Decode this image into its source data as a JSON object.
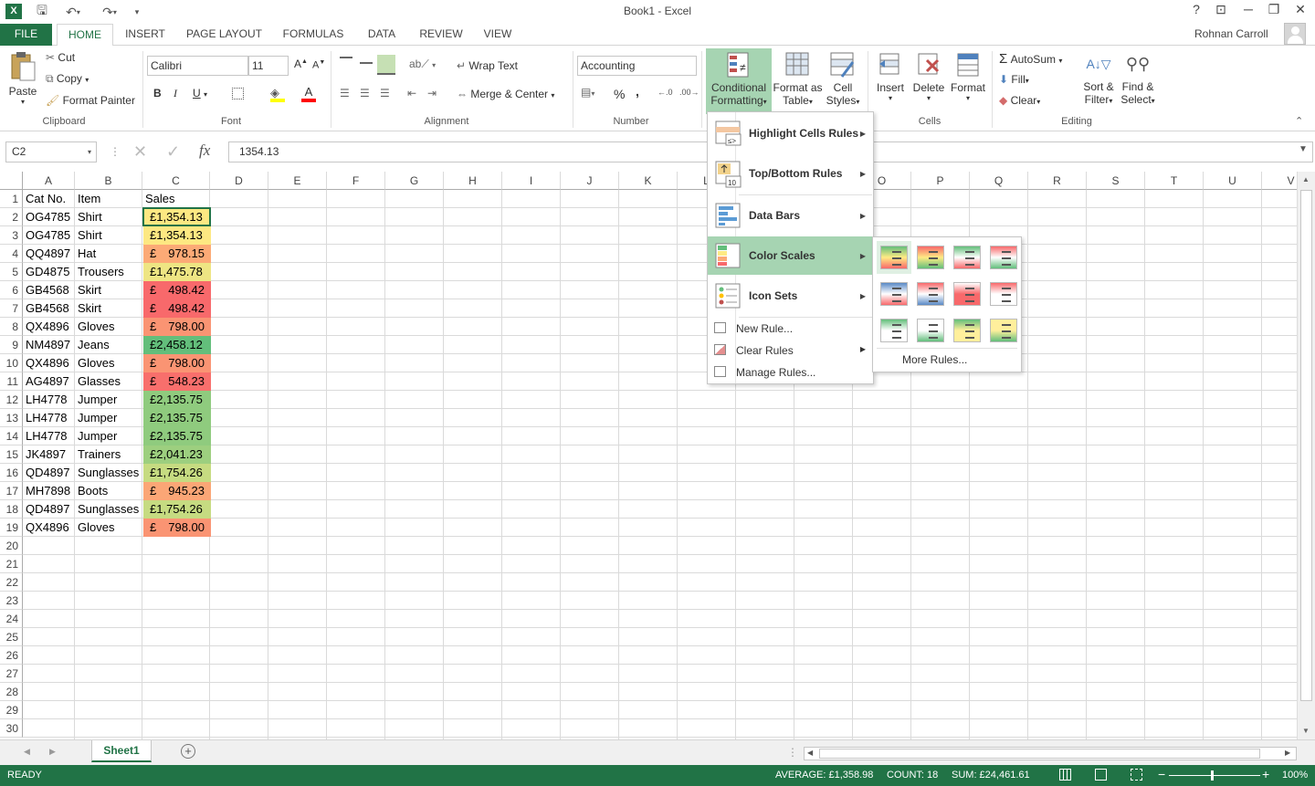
{
  "window": {
    "title": "Book1 - Excel",
    "help": "?",
    "minimize": "─",
    "restore": "❐",
    "close": "✕"
  },
  "tabs": [
    "FILE",
    "HOME",
    "INSERT",
    "PAGE LAYOUT",
    "FORMULAS",
    "DATA",
    "REVIEW",
    "VIEW"
  ],
  "user": "Rohnan Carroll",
  "ribbon": {
    "clipboard": {
      "paste": "Paste",
      "cut": "Cut",
      "copy": "Copy",
      "format_painter": "Format Painter",
      "label": "Clipboard"
    },
    "font": {
      "name": "Calibri",
      "size": "11",
      "bold": "B",
      "italic": "I",
      "underline": "U",
      "label": "Font"
    },
    "alignment": {
      "wrap": "Wrap Text",
      "merge": "Merge & Center",
      "label": "Alignment"
    },
    "number": {
      "format": "Accounting",
      "percent": "%",
      "comma": ",",
      "label": "Number"
    },
    "styles": {
      "cf1": "Conditional",
      "cf2": "Formatting",
      "ft1": "Format as",
      "ft2": "Table",
      "cs1": "Cell",
      "cs2": "Styles"
    },
    "cells": {
      "insert": "Insert",
      "delete": "Delete",
      "format": "Format",
      "label": "Cells"
    },
    "editing": {
      "autosum": "AutoSum",
      "fill": "Fill",
      "clear": "Clear",
      "sort1": "Sort &",
      "sort2": "Filter",
      "find1": "Find &",
      "find2": "Select",
      "label": "Editing"
    }
  },
  "formula_bar": {
    "name_box": "C2",
    "fx": "fx",
    "value": "1354.13"
  },
  "columns": [
    "A",
    "B",
    "C",
    "D",
    "E",
    "F",
    "G",
    "H",
    "I",
    "J",
    "K",
    "L",
    "M",
    "N",
    "O",
    "P",
    "Q",
    "R",
    "S",
    "T",
    "U",
    "V"
  ],
  "rows": [
    "1",
    "2",
    "3",
    "4",
    "5",
    "6",
    "7",
    "8",
    "9",
    "10",
    "11",
    "12",
    "13",
    "14",
    "15",
    "16",
    "17",
    "18",
    "19",
    "20",
    "21",
    "22",
    "23",
    "24",
    "25",
    "26",
    "27",
    "28",
    "29",
    "30"
  ],
  "headers": {
    "a": "Cat No.",
    "b": "Item",
    "c": "Sales"
  },
  "data": [
    {
      "cat": "OG4785",
      "item": "Shirt",
      "cur": "£1,354.13",
      "amt": "",
      "color": "#fde882"
    },
    {
      "cat": "OG4785",
      "item": "Shirt",
      "cur": "£1,354.13",
      "amt": "",
      "color": "#fde882"
    },
    {
      "cat": "QQ4897",
      "item": "Hat",
      "cur": "£",
      "amt": "978.15",
      "color": "#fcaa76"
    },
    {
      "cat": "GD4875",
      "item": "Trousers",
      "cur": "£1,475.78",
      "amt": "",
      "color": "#eee583"
    },
    {
      "cat": "GB4568",
      "item": "Skirt",
      "cur": "£",
      "amt": "498.42",
      "color": "#f8696b"
    },
    {
      "cat": "GB4568",
      "item": "Skirt",
      "cur": "£",
      "amt": "498.42",
      "color": "#f8696b"
    },
    {
      "cat": "QX4896",
      "item": "Gloves",
      "cur": "£",
      "amt": "798.00",
      "color": "#fa9473"
    },
    {
      "cat": "NM4897",
      "item": "Jeans",
      "cur": "£2,458.12",
      "amt": "",
      "color": "#63be7b"
    },
    {
      "cat": "QX4896",
      "item": "Gloves",
      "cur": "£",
      "amt": "798.00",
      "color": "#fa9473"
    },
    {
      "cat": "AG4897",
      "item": "Glasses",
      "cur": "£",
      "amt": "548.23",
      "color": "#f86f6c"
    },
    {
      "cat": "LH4778",
      "item": "Jumper",
      "cur": "£2,135.75",
      "amt": "",
      "color": "#8fcb7e"
    },
    {
      "cat": "LH4778",
      "item": "Jumper",
      "cur": "£2,135.75",
      "amt": "",
      "color": "#8fcb7e"
    },
    {
      "cat": "LH4778",
      "item": "Jumper",
      "cur": "£2,135.75",
      "amt": "",
      "color": "#8fcb7e"
    },
    {
      "cat": "JK4897",
      "item": "Trainers",
      "cur": "£2,041.23",
      "amt": "",
      "color": "#9dcf7f"
    },
    {
      "cat": "QD4897",
      "item": "Sunglasses",
      "cur": "£1,754.26",
      "amt": "",
      "color": "#c6db81"
    },
    {
      "cat": "MH7898",
      "item": "Boots",
      "cur": "£",
      "amt": "945.23",
      "color": "#fba676"
    },
    {
      "cat": "QD4897",
      "item": "Sunglasses",
      "cur": "£1,754.26",
      "amt": "",
      "color": "#c6db81"
    },
    {
      "cat": "QX4896",
      "item": "Gloves",
      "cur": "£",
      "amt": "798.00",
      "color": "#fa9473"
    }
  ],
  "cf_menu": {
    "highlight": "Highlight Cells Rules",
    "topbottom": "Top/Bottom Rules",
    "databars": "Data Bars",
    "colorscales": "Color Scales",
    "iconsets": "Icon Sets",
    "newrule": "New Rule...",
    "clearrules": "Clear Rules",
    "managerules": "Manage Rules..."
  },
  "color_scales_menu": {
    "more": "More Rules..."
  },
  "sheet_tab": "Sheet1",
  "status": {
    "ready": "READY",
    "average": "AVERAGE: £1,358.98",
    "count": "COUNT: 18",
    "sum": "SUM: £24,461.61",
    "zoom": "100%"
  }
}
